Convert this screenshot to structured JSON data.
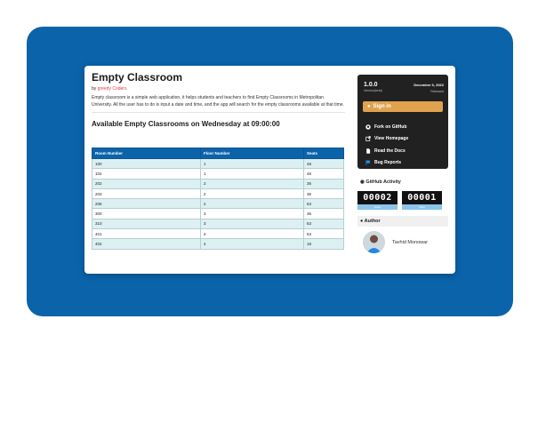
{
  "app": {
    "title": "Empty Classroom",
    "by_label": "by",
    "author_org": "greedy Coders",
    "description": "Empty classroom is a simple web application, it helps students and teachers to find Empty Classrooms in Metropolitan University. All the user has to do is input a date and time, and the app will search for the empty classrooms available at that time.",
    "section_title": "Available Empty Classrooms on Wednesday at 09:00:00"
  },
  "table": {
    "headers": [
      "Room Number",
      "Floor Number",
      "Seats"
    ],
    "rows": [
      [
        "100",
        "1",
        "48"
      ],
      [
        "102",
        "1",
        "48"
      ],
      [
        "202",
        "2",
        "36"
      ],
      [
        "203",
        "2",
        "36"
      ],
      [
        "205",
        "2",
        "63"
      ],
      [
        "300",
        "3",
        "36"
      ],
      [
        "310",
        "3",
        "63"
      ],
      [
        "401",
        "4",
        "63"
      ],
      [
        "402",
        "4",
        "18"
      ]
    ]
  },
  "sidebar": {
    "version": "1.0.0",
    "version_label": "Version(beta)",
    "release_date": "December 6, 2022",
    "release_label": "Released",
    "signin_label": "Sign in",
    "menu": [
      {
        "label": "Fork on GitHub",
        "icon": "github-icon"
      },
      {
        "label": "View Homepage",
        "icon": "external-link-icon"
      },
      {
        "label": "Read the Docs",
        "icon": "document-icon"
      },
      {
        "label": "Bug Reports",
        "icon": "flag-icon"
      }
    ],
    "github_activity_title": "GitHub Activity",
    "counters": [
      {
        "value": "00002",
        "label": "Forks"
      },
      {
        "value": "00001",
        "label": "Stars"
      }
    ],
    "author_title": "Author",
    "author_name": "Tavhid Monowar"
  },
  "colors": {
    "brand_blue": "#0b63aa",
    "accent_orange": "#e0a24f",
    "author_red": "#e53935",
    "row_tint": "#dcf0f2"
  }
}
